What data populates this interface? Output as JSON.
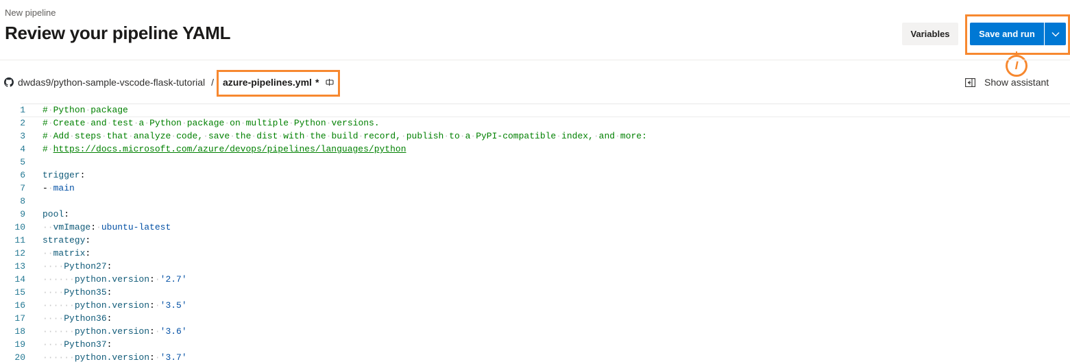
{
  "header": {
    "breadcrumb": "New pipeline",
    "title": "Review your pipeline YAML",
    "variables_label": "Variables",
    "save_run_label": "Save and run"
  },
  "annotation": {
    "callout": "I"
  },
  "repo": {
    "name": "dwdas9/python-sample-vscode-flask-tutorial",
    "separator": "/",
    "file_name": "azure-pipelines.yml",
    "modified_marker": "*"
  },
  "assistant": {
    "label": "Show assistant"
  },
  "icons": {
    "github": "github-icon",
    "rename": "rename-icon",
    "assistant": "show-assistant-icon",
    "dropdown": "chevron-down-icon"
  },
  "colors": {
    "accent": "#0078d4",
    "highlight": "#f7882f",
    "comment": "#008000"
  },
  "editor": {
    "line_numbers": [
      "1",
      "2",
      "3",
      "4",
      "5",
      "6",
      "7",
      "8",
      "9",
      "10",
      "11",
      "12",
      "13",
      "14",
      "15",
      "16",
      "17",
      "18",
      "19",
      "20"
    ],
    "lines": [
      "# Python package",
      "# Create and test a Python package on multiple Python versions.",
      "# Add steps that analyze code, save the dist with the build record, publish to a PyPI-compatible index, and more:",
      "# https://docs.microsoft.com/azure/devops/pipelines/languages/python",
      "",
      "trigger:",
      "- main",
      "",
      "pool:",
      "  vmImage: ubuntu-latest",
      "strategy:",
      "  matrix:",
      "    Python27:",
      "      python.version: '2.7'",
      "    Python35:",
      "      python.version: '3.5'",
      "    Python36:",
      "      python.version: '3.6'",
      "    Python37:",
      "      python.version: '3.7'"
    ]
  }
}
